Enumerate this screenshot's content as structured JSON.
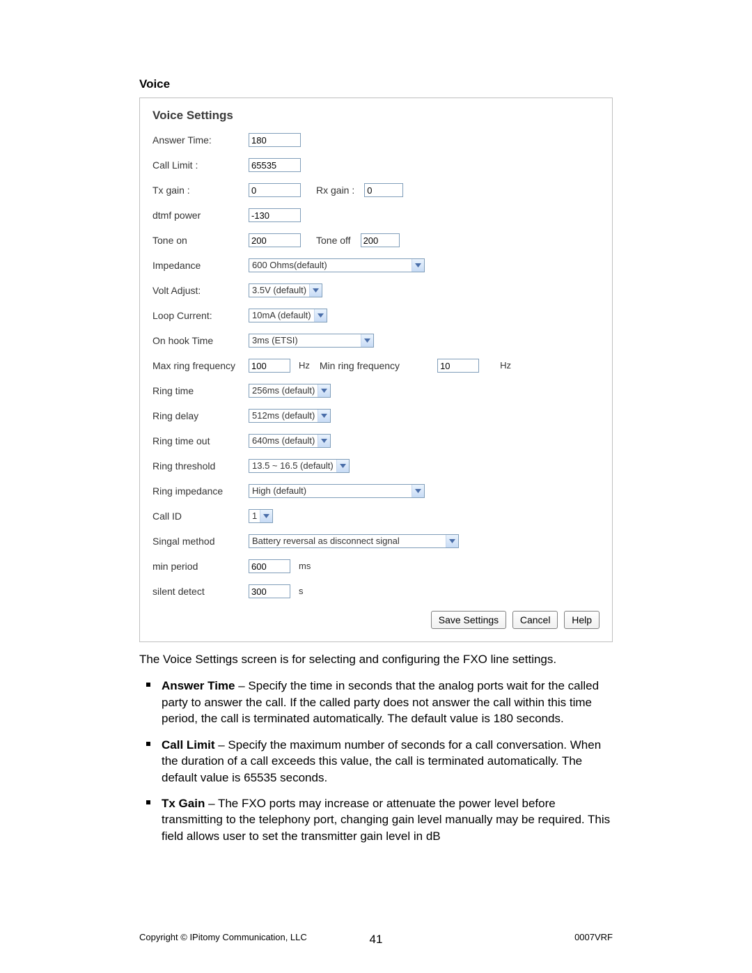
{
  "heading": "Voice",
  "panel": {
    "title": "Voice Settings",
    "rows": {
      "answerTime": {
        "label": "Answer Time:",
        "value": "180"
      },
      "callLimit": {
        "label": "Call Limit :",
        "value": "65535"
      },
      "txGain": {
        "label": "Tx gain :",
        "value": "0"
      },
      "rxGain": {
        "label": "Rx gain :",
        "value": "0"
      },
      "dtmfPower": {
        "label": "dtmf power",
        "value": "-130"
      },
      "toneOn": {
        "label": "Tone on",
        "value": "200"
      },
      "toneOff": {
        "label": "Tone off",
        "value": "200"
      },
      "impedance": {
        "label": "Impedance",
        "value": "600 Ohms(default)"
      },
      "voltAdjust": {
        "label": "Volt Adjust:",
        "value": "3.5V (default)"
      },
      "loopCurrent": {
        "label": "Loop Current:",
        "value": "10mA (default)"
      },
      "onHookTime": {
        "label": "On hook Time",
        "value": "3ms (ETSI)"
      },
      "maxRingFreq": {
        "label": "Max ring frequency",
        "value": "100",
        "unit": "Hz"
      },
      "minRingFreq": {
        "label": "Min ring frequency",
        "value": "10",
        "unit": "Hz"
      },
      "ringTime": {
        "label": "Ring time",
        "value": "256ms (default)"
      },
      "ringDelay": {
        "label": "Ring delay",
        "value": "512ms (default)"
      },
      "ringTimeOut": {
        "label": "Ring time out",
        "value": "640ms (default)"
      },
      "ringThreshold": {
        "label": "Ring threshold",
        "value": "13.5 ~ 16.5 (default)"
      },
      "ringImpedance": {
        "label": "Ring impedance",
        "value": "High (default)"
      },
      "callId": {
        "label": "Call ID",
        "value": "1"
      },
      "signalMethod": {
        "label": "Singal method",
        "value": "Battery reversal as disconnect signal"
      },
      "minPeriod": {
        "label": "min period",
        "value": "600",
        "unit": "ms"
      },
      "silentDetect": {
        "label": "silent detect",
        "value": "300",
        "unit": "s"
      }
    },
    "buttons": {
      "save": "Save  Settings",
      "cancel": "Cancel",
      "help": "Help"
    }
  },
  "description": "The Voice Settings screen is for selecting and configuring the FXO line settings.",
  "bullets": [
    {
      "term": "Answer Time",
      "text": " – Specify the time in seconds that the analog ports wait for the called party to answer the call. If the called party does not answer the call within this time period, the call is terminated automatically. The default value is 180 seconds."
    },
    {
      "term": "Call Limit",
      "text": " – Specify the maximum number of seconds for a call conversation. When the duration of a call exceeds this value, the call is terminated automatically. The default value is 65535 seconds."
    },
    {
      "term": "Tx Gain",
      "text": " – The FXO ports may increase or attenuate the power level before transmitting to the telephony port, changing gain level manually may be required. This field allows user to set the transmitter gain level in dB"
    }
  ],
  "footer": {
    "left": "Copyright © IPitomy Communication, LLC",
    "center": "41",
    "right": "0007VRF"
  }
}
